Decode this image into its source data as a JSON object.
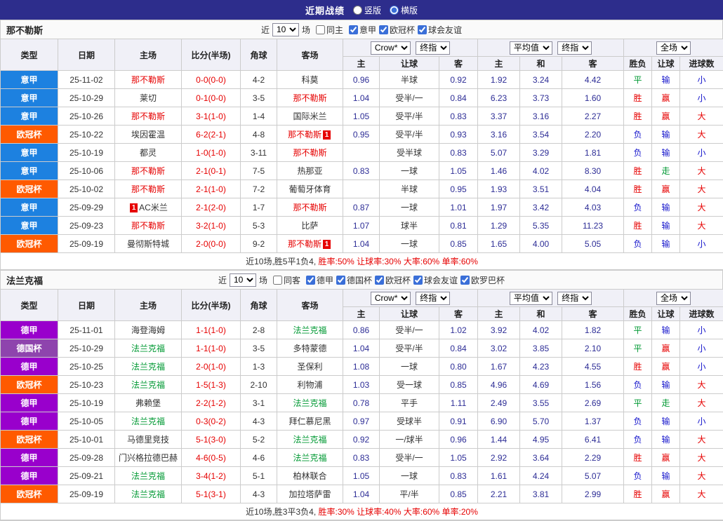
{
  "topbar": {
    "title": "近期战绩",
    "vertical_label": "竖版",
    "horizontal_label": "横版"
  },
  "filters": {
    "near_label": "近",
    "games_label": "场"
  },
  "table_header": {
    "type": "类型",
    "date": "日期",
    "home": "主场",
    "score": "比分(半场)",
    "corner": "角球",
    "away": "客场",
    "company": "Crow*",
    "final": "终指",
    "average": "平均值",
    "full": "全场",
    "odds_home": "主",
    "odds_handicap": "让球",
    "odds_away": "客",
    "avg_home": "主",
    "avg_draw": "和",
    "avg_away": "客",
    "result_wdl": "胜负",
    "result_handicap": "让球",
    "result_goals": "进球数"
  },
  "colors": {
    "topbar_bg": "#2d2d8c",
    "leagues": {
      "意甲": "#1d81e0",
      "欧冠杯": "#ff5a00",
      "德甲": "#9900cc",
      "德国杯": "#8e44ad"
    },
    "results": {
      "win": "#e60000",
      "loss": "#1616cc",
      "push": "#009933"
    },
    "score": "#e60000",
    "odds": "#2d2d96"
  },
  "sections": [
    {
      "team": "那不勒斯",
      "team_color": "#e60000",
      "filter": {
        "count": "10",
        "same_label": "同主",
        "leagues": [
          "意甲",
          "欧冠杯",
          "球会友谊"
        ]
      },
      "rows": [
        {
          "lg": "意甲",
          "date": "25-11-02",
          "home": "那不勒斯",
          "hh": 1,
          "score": "0-0(0-0)",
          "corner": "4-2",
          "away": "科莫",
          "o1": "0.96",
          "h": "半球",
          "o2": "0.92",
          "m1": "1.92",
          "m2": "3.24",
          "m3": "4.42",
          "r1": "平",
          "r2": "输",
          "r3": "小"
        },
        {
          "lg": "意甲",
          "date": "25-10-29",
          "home": "莱切",
          "score": "0-1(0-0)",
          "corner": "3-5",
          "away": "那不勒斯",
          "ah": 1,
          "o1": "1.04",
          "h": "受半/一",
          "o2": "0.84",
          "m1": "6.23",
          "m2": "3.73",
          "m3": "1.60",
          "r1": "胜",
          "r2": "赢",
          "r3": "小"
        },
        {
          "lg": "意甲",
          "date": "25-10-26",
          "home": "那不勒斯",
          "hh": 1,
          "score": "3-1(1-0)",
          "corner": "1-4",
          "away": "国际米兰",
          "o1": "1.05",
          "h": "受平/半",
          "o2": "0.83",
          "m1": "3.37",
          "m2": "3.16",
          "m3": "2.27",
          "r1": "胜",
          "r2": "赢",
          "r3": "大"
        },
        {
          "lg": "欧冠杯",
          "date": "25-10-22",
          "home": "埃因霍温",
          "score": "6-2(2-1)",
          "corner": "4-8",
          "away": "那不勒斯",
          "ah": 1,
          "ab": "1",
          "o1": "0.95",
          "h": "受平/半",
          "o2": "0.93",
          "m1": "3.16",
          "m2": "3.54",
          "m3": "2.20",
          "r1": "负",
          "r2": "输",
          "r3": "大"
        },
        {
          "lg": "意甲",
          "date": "25-10-19",
          "home": "都灵",
          "score": "1-0(1-0)",
          "corner": "3-11",
          "away": "那不勒斯",
          "ah": 1,
          "o1": "",
          "h": "受半球",
          "o2": "0.83",
          "m1": "5.07",
          "m2": "3.29",
          "m3": "1.81",
          "r1": "负",
          "r2": "输",
          "r3": "小"
        },
        {
          "lg": "意甲",
          "date": "25-10-06",
          "home": "那不勒斯",
          "hh": 1,
          "score": "2-1(0-1)",
          "corner": "7-5",
          "away": "热那亚",
          "o1": "0.83",
          "h": "一球",
          "o2": "1.05",
          "m1": "1.46",
          "m2": "4.02",
          "m3": "8.30",
          "r1": "胜",
          "r2": "走",
          "r3": "大"
        },
        {
          "lg": "欧冠杯",
          "date": "25-10-02",
          "home": "那不勒斯",
          "hh": 1,
          "score": "2-1(1-0)",
          "corner": "7-2",
          "away": "葡萄牙体育",
          "o1": "",
          "h": "半球",
          "o2": "0.95",
          "m1": "1.93",
          "m2": "3.51",
          "m3": "4.04",
          "r1": "胜",
          "r2": "赢",
          "r3": "大"
        },
        {
          "lg": "意甲",
          "date": "25-09-29",
          "home": "AC米兰",
          "hbp": "1",
          "score": "2-1(2-0)",
          "corner": "1-7",
          "away": "那不勒斯",
          "ah": 1,
          "o1": "0.87",
          "h": "一球",
          "o2": "1.01",
          "m1": "1.97",
          "m2": "3.42",
          "m3": "4.03",
          "r1": "负",
          "r2": "输",
          "r3": "大"
        },
        {
          "lg": "意甲",
          "date": "25-09-23",
          "home": "那不勒斯",
          "hh": 1,
          "score": "3-2(1-0)",
          "corner": "5-3",
          "away": "比萨",
          "o1": "1.07",
          "h": "球半",
          "o2": "0.81",
          "m1": "1.29",
          "m2": "5.35",
          "m3": "11.23",
          "r1": "胜",
          "r2": "输",
          "r3": "大"
        },
        {
          "lg": "欧冠杯",
          "date": "25-09-19",
          "home": "曼彻斯特城",
          "score": "2-0(0-0)",
          "corner": "9-2",
          "away": "那不勒斯",
          "ah": 1,
          "ab": "1",
          "o1": "1.04",
          "h": "一球",
          "o2": "0.85",
          "m1": "1.65",
          "m2": "4.00",
          "m3": "5.05",
          "r1": "负",
          "r2": "输",
          "r3": "小"
        }
      ],
      "summary": [
        {
          "t": "近10场,胜5平1负4, ",
          "red": false
        },
        {
          "t": "胜率:50% ",
          "red": true
        },
        {
          "t": "让球率:30% ",
          "red": true
        },
        {
          "t": "大率:60% ",
          "red": true
        },
        {
          "t": "单率:60%",
          "red": true
        }
      ]
    },
    {
      "team": "法兰克福",
      "team_color": "#009933",
      "filter": {
        "count": "10",
        "same_label": "同客",
        "leagues": [
          "德甲",
          "德国杯",
          "欧冠杯",
          "球会友谊",
          "欧罗巴杯"
        ]
      },
      "rows": [
        {
          "lg": "德甲",
          "date": "25-11-01",
          "home": "海登海姆",
          "score": "1-1(1-0)",
          "corner": "2-8",
          "away": "法兰克福",
          "ah": 1,
          "o1": "0.86",
          "h": "受半/一",
          "o2": "1.02",
          "m1": "3.92",
          "m2": "4.02",
          "m3": "1.82",
          "r1": "平",
          "r2": "输",
          "r3": "小"
        },
        {
          "lg": "德国杯",
          "date": "25-10-29",
          "home": "法兰克福",
          "hh": 1,
          "score": "1-1(1-0)",
          "corner": "3-5",
          "away": "多特蒙德",
          "o1": "1.04",
          "h": "受平/半",
          "o2": "0.84",
          "m1": "3.02",
          "m2": "3.85",
          "m3": "2.10",
          "r1": "平",
          "r2": "赢",
          "r3": "小"
        },
        {
          "lg": "德甲",
          "date": "25-10-25",
          "home": "法兰克福",
          "hh": 1,
          "score": "2-0(1-0)",
          "corner": "1-3",
          "away": "圣保利",
          "o1": "1.08",
          "h": "一球",
          "o2": "0.80",
          "m1": "1.67",
          "m2": "4.23",
          "m3": "4.55",
          "r1": "胜",
          "r2": "赢",
          "r3": "小"
        },
        {
          "lg": "欧冠杯",
          "date": "25-10-23",
          "home": "法兰克福",
          "hh": 1,
          "score": "1-5(1-3)",
          "corner": "2-10",
          "away": "利物浦",
          "o1": "1.03",
          "h": "受一球",
          "o2": "0.85",
          "m1": "4.96",
          "m2": "4.69",
          "m3": "1.56",
          "r1": "负",
          "r2": "输",
          "r3": "大"
        },
        {
          "lg": "德甲",
          "date": "25-10-19",
          "home": "弗赖堡",
          "score": "2-2(1-2)",
          "corner": "3-1",
          "away": "法兰克福",
          "ah": 1,
          "o1": "0.78",
          "h": "平手",
          "o2": "1.11",
          "m1": "2.49",
          "m2": "3.55",
          "m3": "2.69",
          "r1": "平",
          "r2": "走",
          "r3": "大"
        },
        {
          "lg": "德甲",
          "date": "25-10-05",
          "home": "法兰克福",
          "hh": 1,
          "score": "0-3(0-2)",
          "corner": "4-3",
          "away": "拜仁慕尼黑",
          "o1": "0.97",
          "h": "受球半",
          "o2": "0.91",
          "m1": "6.90",
          "m2": "5.70",
          "m3": "1.37",
          "r1": "负",
          "r2": "输",
          "r3": "小"
        },
        {
          "lg": "欧冠杯",
          "date": "25-10-01",
          "home": "马德里竞技",
          "score": "5-1(3-0)",
          "corner": "5-2",
          "away": "法兰克福",
          "ah": 1,
          "o1": "0.92",
          "h": "一/球半",
          "o2": "0.96",
          "m1": "1.44",
          "m2": "4.95",
          "m3": "6.41",
          "r1": "负",
          "r2": "输",
          "r3": "大"
        },
        {
          "lg": "德甲",
          "date": "25-09-28",
          "home": "门兴格拉德巴赫",
          "score": "4-6(0-5)",
          "corner": "4-6",
          "away": "法兰克福",
          "ah": 1,
          "o1": "0.83",
          "h": "受半/一",
          "o2": "1.05",
          "m1": "2.92",
          "m2": "3.64",
          "m3": "2.29",
          "r1": "胜",
          "r2": "赢",
          "r3": "大"
        },
        {
          "lg": "德甲",
          "date": "25-09-21",
          "home": "法兰克福",
          "hh": 1,
          "score": "3-4(1-2)",
          "corner": "5-1",
          "away": "柏林联合",
          "o1": "1.05",
          "h": "一球",
          "o2": "0.83",
          "m1": "1.61",
          "m2": "4.24",
          "m3": "5.07",
          "r1": "负",
          "r2": "输",
          "r3": "大"
        },
        {
          "lg": "欧冠杯",
          "date": "25-09-19",
          "home": "法兰克福",
          "hh": 1,
          "score": "5-1(3-1)",
          "corner": "4-3",
          "away": "加拉塔萨雷",
          "o1": "1.04",
          "h": "平/半",
          "o2": "0.85",
          "m1": "2.21",
          "m2": "3.81",
          "m3": "2.99",
          "r1": "胜",
          "r2": "赢",
          "r3": "大"
        }
      ],
      "summary": [
        {
          "t": "近10场,胜3平3负4, ",
          "red": false
        },
        {
          "t": "胜率:30% ",
          "red": true
        },
        {
          "t": "让球率:40% ",
          "red": true
        },
        {
          "t": "大率:60% ",
          "red": true
        },
        {
          "t": "单率:20%",
          "red": true
        }
      ]
    }
  ]
}
